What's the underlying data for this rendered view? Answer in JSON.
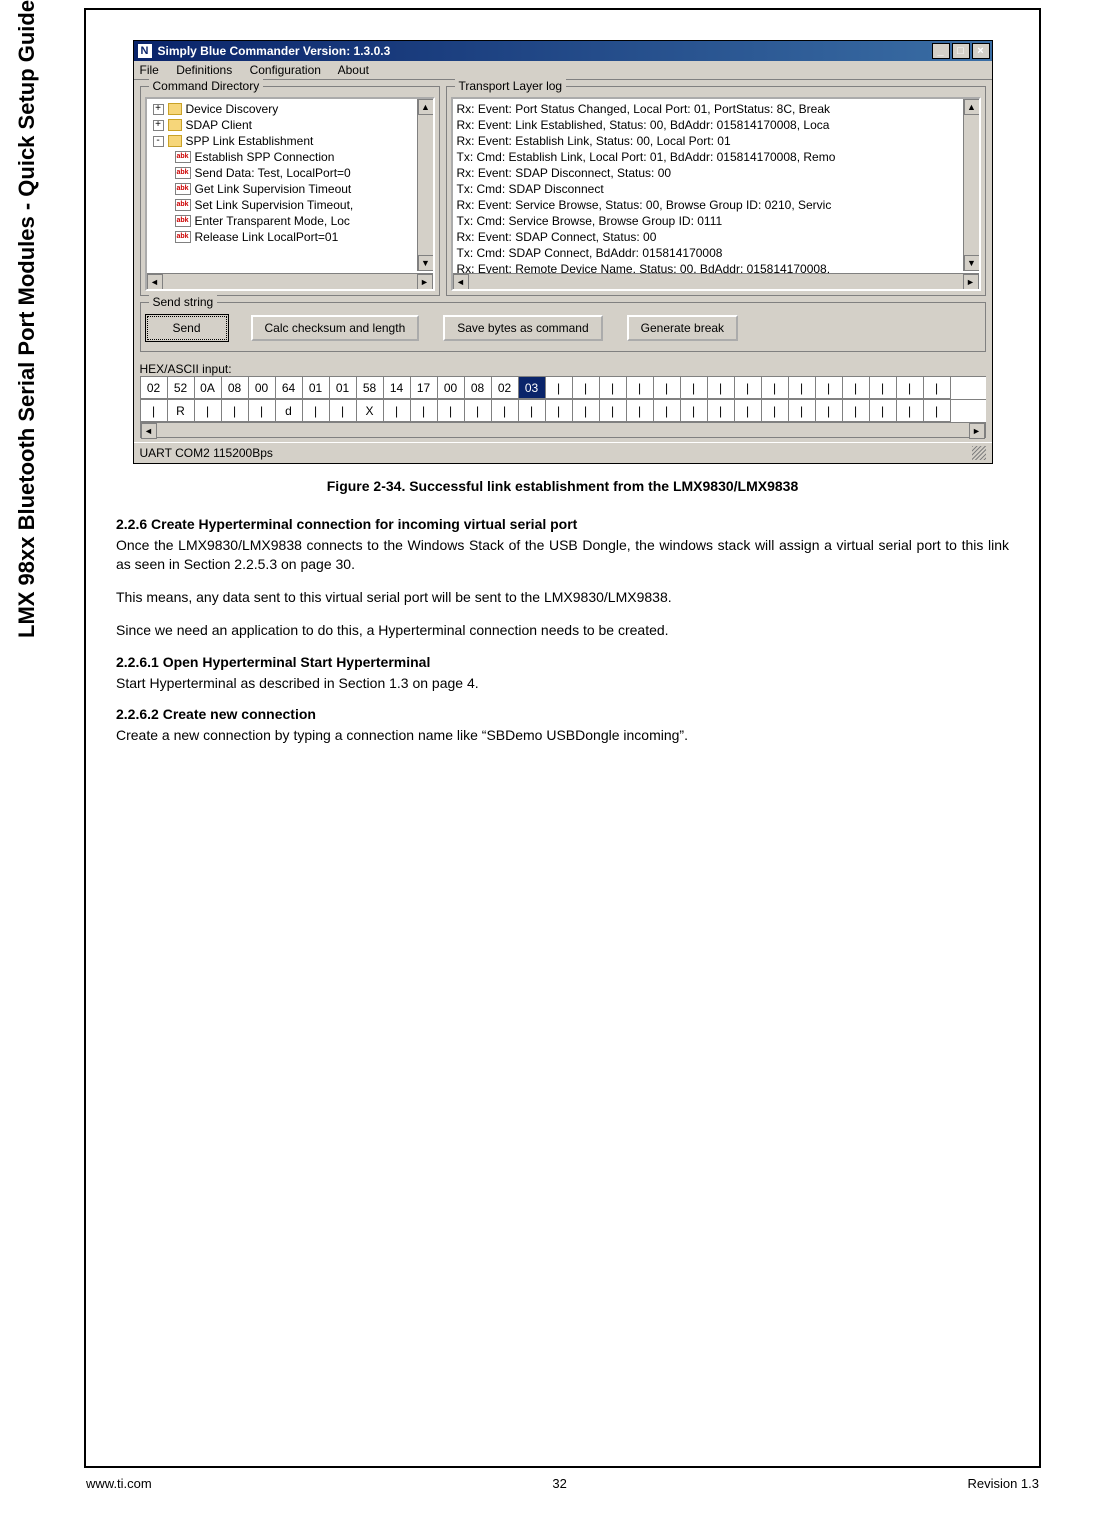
{
  "side_title": "LMX 98xx Bluetooth Serial Port Modules - Quick Setup Guide",
  "app": {
    "title": "Simply Blue Commander    Version: 1.3.0.3",
    "win_min": "_",
    "win_max": "□",
    "win_close": "×",
    "menu": {
      "file": "File",
      "definitions": "Definitions",
      "configuration": "Configuration",
      "about": "About"
    },
    "cmd_dir": {
      "legend": "Command Directory",
      "folders": [
        {
          "exp": "+",
          "label": "Device Discovery"
        },
        {
          "exp": "+",
          "label": "SDAP Client"
        },
        {
          "exp": "-",
          "label": "SPP Link Establishment"
        }
      ],
      "leaves": [
        "Establish SPP Connection",
        "Send Data: Test, LocalPort=0",
        "Get Link Supervision Timeout",
        "Set Link Supervision Timeout,",
        "Enter Transparent Mode, Loc",
        "Release Link LocalPort=01"
      ]
    },
    "transport": {
      "legend": "Transport Layer log",
      "lines": [
        "Rx: Event: Port Status Changed, Local Port: 01, PortStatus: 8C, Break",
        "Rx: Event: Link Established, Status: 00, BdAddr: 015814170008, Loca",
        "Rx: Event: Establish Link, Status: 00, Local Port: 01",
        "Tx: Cmd: Establish Link, Local Port: 01, BdAddr: 015814170008, Remo",
        "Rx: Event: SDAP Disconnect, Status: 00",
        "Tx: Cmd: SDAP Disconnect",
        "Rx: Event: Service Browse, Status: 00, Browse Group ID: 0210, Servic",
        "Tx: Cmd: Service Browse, Browse Group ID: 0111",
        "Rx: Event: SDAP Connect, Status: 00",
        "Tx: Cmd: SDAP Connect, BdAddr: 015814170008",
        "Rx: Event: Remote Device Name, Status: 00, BdAddr: 015814170008,"
      ]
    },
    "send": {
      "legend": "Send string",
      "buttons": {
        "send": "Send",
        "calc": "Calc checksum and length",
        "save": "Save bytes as command",
        "brk": "Generate break"
      }
    },
    "hex_label": "HEX/ASCII input:",
    "hex_row1": [
      "02",
      "52",
      "0A",
      "08",
      "00",
      "64",
      "01",
      "01",
      "58",
      "14",
      "17",
      "00",
      "08",
      "02",
      "03",
      "|",
      "|",
      "|",
      "|",
      "|",
      "|",
      "|",
      "|",
      "|",
      "|",
      "|",
      "|",
      "|",
      "|",
      "|"
    ],
    "hex_sel_index": 14,
    "hex_row2": [
      "|",
      "R",
      "|",
      "|",
      "|",
      "d",
      "|",
      "|",
      "X",
      "|",
      "|",
      "|",
      "|",
      "|",
      "|",
      "|",
      "|",
      "|",
      "|",
      "|",
      "|",
      "|",
      "|",
      "|",
      "|",
      "|",
      "|",
      "|",
      "|",
      "|"
    ],
    "status": "UART COM2    115200Bps"
  },
  "figure_caption": "Figure 2-34.  Successful link establishment from the LMX9830/LMX9838",
  "s226": {
    "head": "2.2.6    Create Hyperterminal connection for incoming virtual serial port",
    "p1": "Once the LMX9830/LMX9838 connects to the Windows Stack of the USB Dongle, the windows stack will assign a virtual serial port to this link as seen in Section 2.2.5.3 on page 30.",
    "p2": "This means, any data sent to this virtual serial port will be sent to the LMX9830/LMX9838.",
    "p3": "Since we need an application to do this, a Hyperterminal connection needs to be created."
  },
  "s2261": {
    "head": "2.2.6.1    Open Hyperterminal Start Hyperterminal",
    "p1": "Start Hyperterminal as described in Section 1.3 on page 4."
  },
  "s2262": {
    "head": "2.2.6.2    Create new connection",
    "p1": "Create a new connection by typing a connection name like “SBDemo USBDongle incoming”."
  },
  "footer": {
    "left": "www.ti.com",
    "center": "32",
    "right": "Revision 1.3"
  }
}
